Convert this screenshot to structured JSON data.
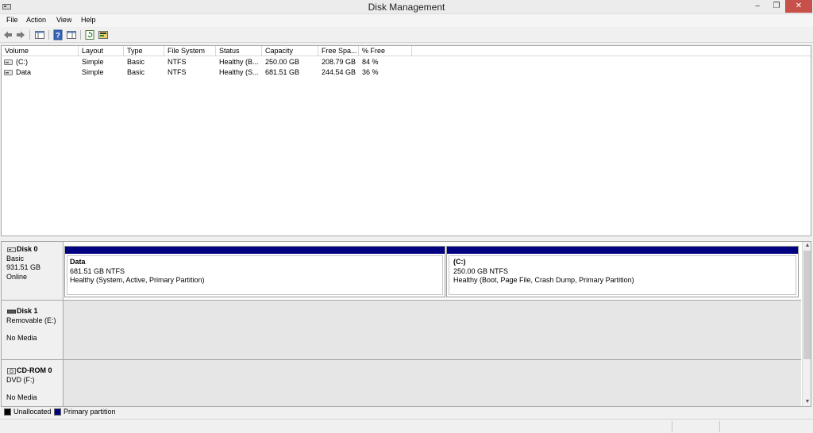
{
  "window": {
    "title": "Disk Management"
  },
  "menu": [
    "File",
    "Action",
    "View",
    "Help"
  ],
  "toolbar": {
    "buttons": [
      "back-icon",
      "forward-icon",
      "console-tree-icon",
      "help-icon",
      "properties-icon",
      "refresh-icon",
      "rescan-disks-icon"
    ]
  },
  "volumes": {
    "columns": [
      "Volume",
      "Layout",
      "Type",
      "File System",
      "Status",
      "Capacity",
      "Free Spa...",
      "% Free"
    ],
    "rows": [
      {
        "volume": "(C:)",
        "layout": "Simple",
        "type": "Basic",
        "fs": "NTFS",
        "status": "Healthy (B...",
        "capacity": "250.00 GB",
        "free": "208.79 GB",
        "pct": "84 %"
      },
      {
        "volume": "Data",
        "layout": "Simple",
        "type": "Basic",
        "fs": "NTFS",
        "status": "Healthy (S...",
        "capacity": "681.51 GB",
        "free": "244.54 GB",
        "pct": "36 %"
      }
    ]
  },
  "disks": {
    "disk0": {
      "name": "Disk 0",
      "type": "Basic",
      "size": "931.51 GB",
      "state": "Online",
      "partitions": [
        {
          "name": "Data",
          "size": "681.51 GB NTFS",
          "status": "Healthy (System, Active, Primary Partition)"
        },
        {
          "name": "(C:)",
          "size": "250.00 GB NTFS",
          "status": "Healthy (Boot, Page File, Crash Dump, Primary Partition)"
        }
      ]
    },
    "disk1": {
      "name": "Disk 1",
      "type": "Removable (E:)",
      "state": "No Media"
    },
    "cdrom0": {
      "name": "CD-ROM 0",
      "type": "DVD (F:)",
      "state": "No Media"
    }
  },
  "legend": [
    {
      "label": "Unallocated",
      "color": "#000000"
    },
    {
      "label": "Primary partition",
      "color": "#000080"
    }
  ],
  "colors": {
    "primary_partition": "#000080",
    "unallocated": "#000000",
    "close_button": "#c7504a"
  }
}
